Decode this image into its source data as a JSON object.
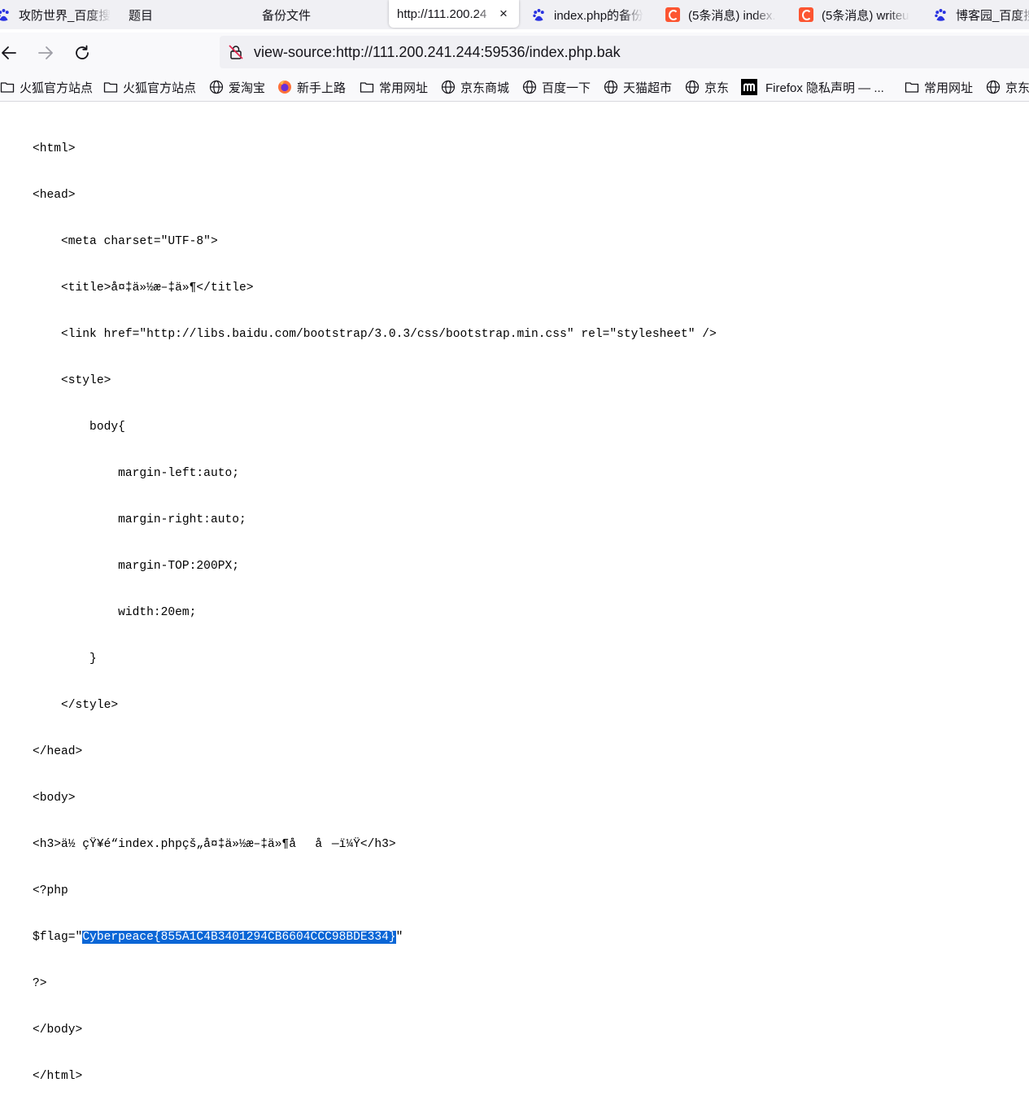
{
  "tabs": [
    {
      "label": "攻防世界_百度搜",
      "icon": "baidu-paw-icon"
    },
    {
      "label": "题目",
      "icon": ""
    },
    {
      "label": "备份文件",
      "icon": ""
    },
    {
      "label": "http://111.200.24",
      "icon": "",
      "active": true
    },
    {
      "label": "index.php的备份",
      "icon": "baidu-paw-icon"
    },
    {
      "label": "(5条消息) index.",
      "icon": "csdn-icon"
    },
    {
      "label": "(5条消息) writeu",
      "icon": "csdn-icon"
    },
    {
      "label": "博客园_百度搜",
      "icon": "baidu-paw-icon"
    }
  ],
  "active_tab_close": "×",
  "address_bar": {
    "url": "view-source:http://111.200.241.244:59536/index.php.bak"
  },
  "bookmarks": [
    {
      "label": "火狐官方站点",
      "icon": "folder-icon"
    },
    {
      "label": "火狐官方站点",
      "icon": "folder-icon"
    },
    {
      "label": "爱淘宝",
      "icon": "globe-icon"
    },
    {
      "label": "新手上路",
      "icon": "firefox-icon"
    },
    {
      "label": "常用网址",
      "icon": "folder-icon"
    },
    {
      "label": "京东商城",
      "icon": "globe-icon"
    },
    {
      "label": "百度一下",
      "icon": "globe-icon"
    },
    {
      "label": "天猫超市",
      "icon": "globe-icon"
    },
    {
      "label": "京东",
      "icon": "globe-icon"
    },
    {
      "label": "Firefox 隐私声明 — ...",
      "icon": "mozilla-m-icon"
    },
    {
      "label": "常用网址",
      "icon": "folder-icon"
    },
    {
      "label": "京东",
      "icon": "globe-icon"
    }
  ],
  "source": {
    "l1": "<html>",
    "l2": "<head>",
    "l3": "    <meta charset=\"UTF-8\">",
    "l4": "    <title>å¤‡ä»½æ–‡ä»¶</title>",
    "l5": "    <link href=\"http://libs.baidu.com/bootstrap/3.0.3/css/bootstrap.min.css\" rel=\"stylesheet\" />",
    "l6": "    <style>",
    "l7": "        body{",
    "l8": "            margin-left:auto;",
    "l9": "            margin-right:auto;",
    "l10": "            margin-TOP:200PX;",
    "l11": "            width:20em;",
    "l12": "        }",
    "l13": "    </style>",
    "l14": "</head>",
    "l15": "<body>",
    "l16": "<h3>ä½ çŸ¥é“index.phpçš„å¤‡ä»½æ–‡ä»¶åå—ï¼Ÿ</h3>",
    "l17": "<?php",
    "l18_pre": "$flag=\"",
    "l18_flag": "Cyberpeace{855A1C4B3401294CB6604CCC98BDE334}",
    "l18_post": "\"",
    "l19": "?>",
    "l20": "</body>",
    "l21": "</html>"
  },
  "colors": {
    "selection": "#0a66d6",
    "tabstrip": "#f0f0f4",
    "toolbar": "#f9f9fb",
    "csdn": "#fc5531"
  }
}
